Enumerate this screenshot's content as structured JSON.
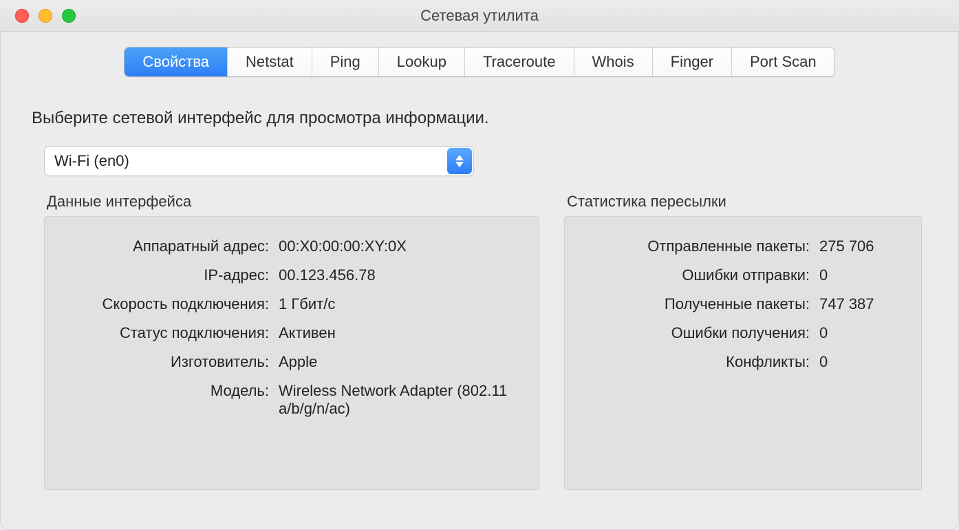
{
  "window": {
    "title": "Сетевая утилита"
  },
  "tabs": [
    {
      "label": "Свойства",
      "active": true
    },
    {
      "label": "Netstat",
      "active": false
    },
    {
      "label": "Ping",
      "active": false
    },
    {
      "label": "Lookup",
      "active": false
    },
    {
      "label": "Traceroute",
      "active": false
    },
    {
      "label": "Whois",
      "active": false
    },
    {
      "label": "Finger",
      "active": false
    },
    {
      "label": "Port Scan",
      "active": false
    }
  ],
  "instruction": "Выберите сетевой интерфейс для просмотра информации.",
  "interface_select": {
    "value": "Wi-Fi (en0)"
  },
  "panels": {
    "info": {
      "title": "Данные интерфейса",
      "rows": {
        "hw_addr": {
          "label": "Аппаратный адрес:",
          "value": "00:X0:00:00:XY:0X"
        },
        "ip_addr": {
          "label": "IP-адрес:",
          "value": "00.123.456.78"
        },
        "link_speed": {
          "label": "Скорость подключения:",
          "value": "1 Гбит/с"
        },
        "link_state": {
          "label": "Статус подключения:",
          "value": "Активен"
        },
        "vendor": {
          "label": "Изготовитель:",
          "value": "Apple"
        },
        "model": {
          "label": "Модель:",
          "value": "Wireless Network Adapter (802.11 a/b/g/n/ac)"
        }
      }
    },
    "stats": {
      "title": "Статистика пересылки",
      "rows": {
        "sent": {
          "label": "Отправленные пакеты:",
          "value": "275 706"
        },
        "send_err": {
          "label": "Ошибки отправки:",
          "value": "0"
        },
        "recv": {
          "label": "Полученные пакеты:",
          "value": "747 387"
        },
        "recv_err": {
          "label": "Ошибки получения:",
          "value": "0"
        },
        "collisions": {
          "label": "Конфликты:",
          "value": "0"
        }
      }
    }
  }
}
